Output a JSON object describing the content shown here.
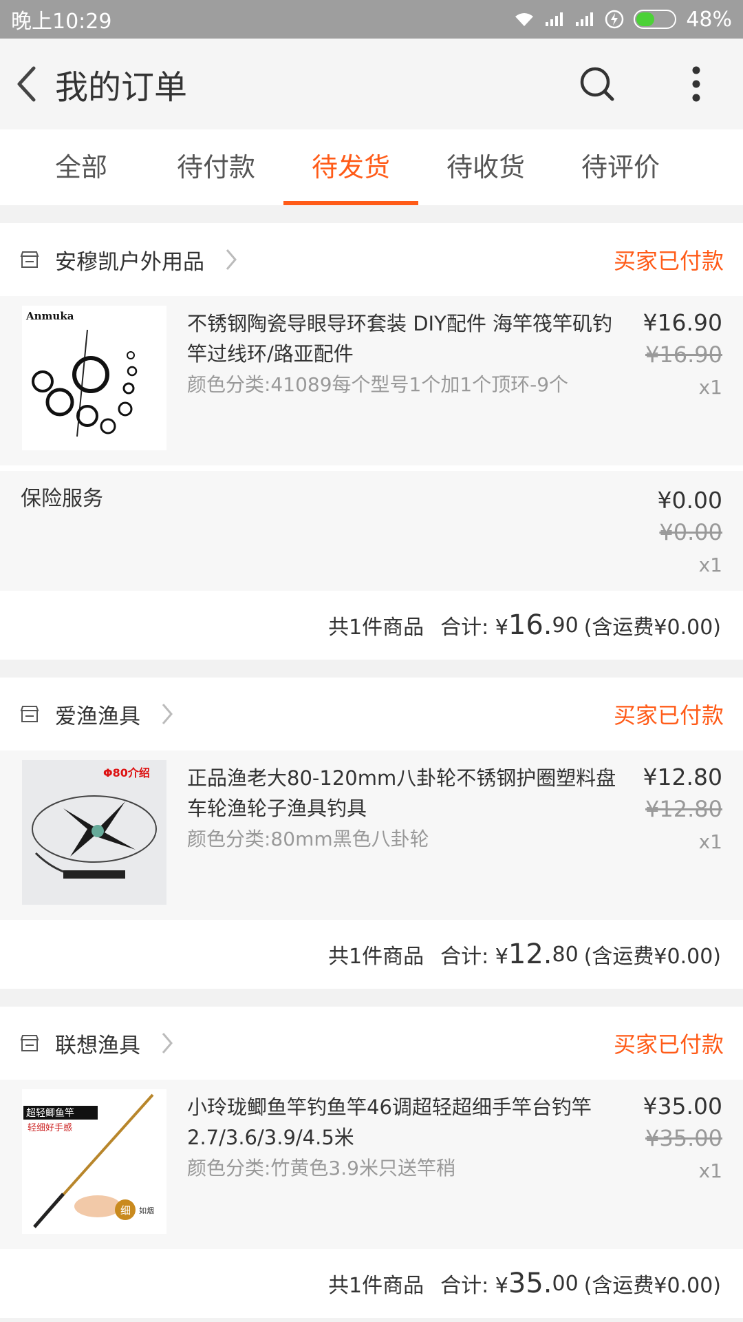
{
  "status_bar": {
    "time": "晚上10:29",
    "battery": "48%",
    "battery_level": 0.48,
    "icons": [
      "wifi-icon",
      "signal-icon",
      "signal-icon",
      "charging-icon",
      "battery-icon"
    ]
  },
  "header": {
    "title": "我的订单",
    "icons": [
      "back-icon",
      "search-icon",
      "more-icon"
    ]
  },
  "tabs": [
    {
      "label": "全部"
    },
    {
      "label": "待付款"
    },
    {
      "label": "待发货",
      "active": true
    },
    {
      "label": "待收货"
    },
    {
      "label": "待评价"
    }
  ],
  "colors": {
    "accent": "#ff5b18",
    "status_bar": "#9e9e9e"
  },
  "orders": [
    {
      "shop": "安穆凯户外用品",
      "status": "买家已付款",
      "item": {
        "title": "不锈钢陶瓷导眼导环套装 DIY配件 海竿筏竿矶钓竿过线环/路亚配件",
        "spec": "颜色分类:41089每个型号1个加1个顶环-9个",
        "price": "¥16.90",
        "original_price": "¥16.90",
        "qty": "x1",
        "image_text": "Anmuka"
      },
      "insurance": {
        "label": "保险服务",
        "price": "¥0.00",
        "original_price": "¥0.00",
        "qty": "x1"
      },
      "summary": {
        "count": "共1件商品",
        "total_label": "合计: ¥",
        "total_int": "16.",
        "total_dec": "90",
        "shipping": "(含运费¥0.00)"
      }
    },
    {
      "shop": "爱渔渔具",
      "status": "买家已付款",
      "item": {
        "title": "正品渔老大80-120mm八卦轮不锈钢护圈塑料盘车轮渔轮子渔具钓具",
        "spec": "颜色分类:80mm黑色八卦轮",
        "price": "¥12.80",
        "original_price": "¥12.80",
        "qty": "x1",
        "image_text": "Φ80介绍"
      },
      "summary": {
        "count": "共1件商品",
        "total_label": "合计: ¥",
        "total_int": "12.",
        "total_dec": "80",
        "shipping": "(含运费¥0.00)"
      }
    },
    {
      "shop": "联想渔具",
      "status": "买家已付款",
      "item": {
        "title": "小玲珑鲫鱼竿钓鱼竿46调超轻超细手竿台钓竿2.7/3.6/3.9/4.5米",
        "spec": "颜色分类:竹黄色3.9米只送竿稍",
        "price": "¥35.00",
        "original_price": "¥35.00",
        "qty": "x1",
        "image_text": "超轻鲫鱼竿",
        "image_text2": "轻细好手感",
        "image_text3": "细",
        "image_text4": "如烟"
      },
      "summary": {
        "count": "共1件商品",
        "total_label": "合计: ¥",
        "total_int": "35.",
        "total_dec": "00",
        "shipping": "(含运费¥0.00)"
      }
    }
  ]
}
